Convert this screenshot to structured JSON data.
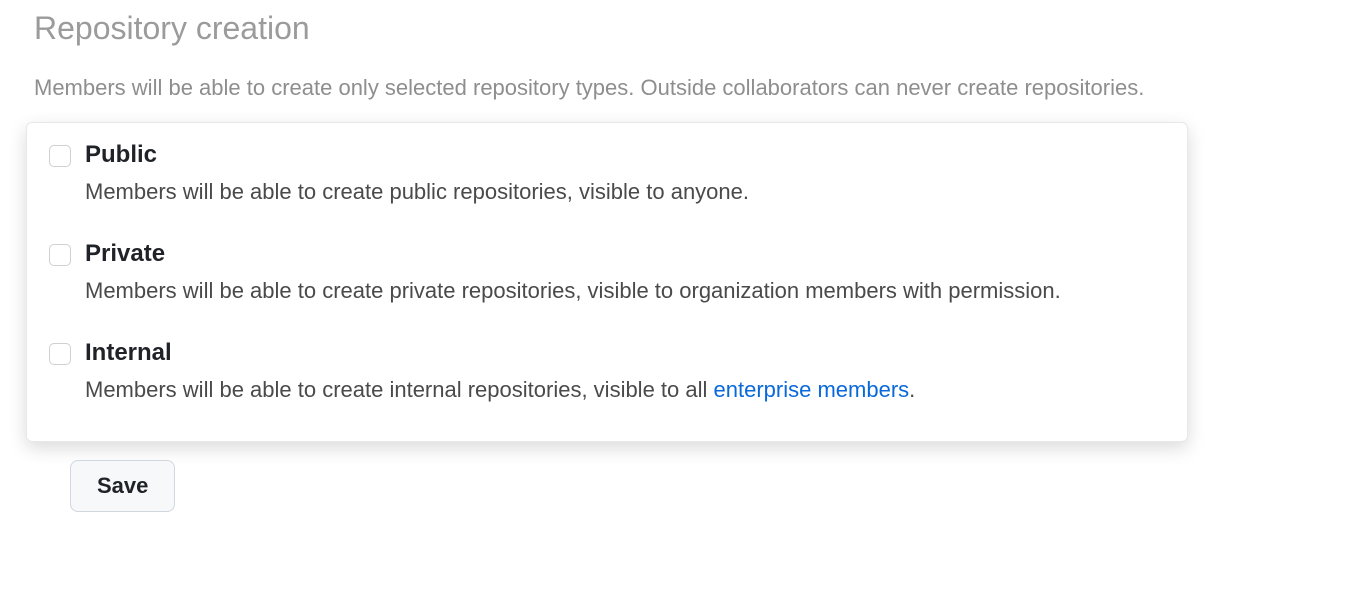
{
  "section": {
    "title": "Repository creation",
    "description": "Members will be able to create only selected repository types. Outside collaborators can never create repositories."
  },
  "options": {
    "public": {
      "label": "Public",
      "description": "Members will be able to create public repositories, visible to anyone."
    },
    "private": {
      "label": "Private",
      "description": "Members will be able to create private repositories, visible to organization members with permission."
    },
    "internal": {
      "label": "Internal",
      "description_prefix": "Members will be able to create internal repositories, visible to all ",
      "link_text": "enterprise members",
      "description_suffix": "."
    }
  },
  "actions": {
    "save_label": "Save"
  }
}
